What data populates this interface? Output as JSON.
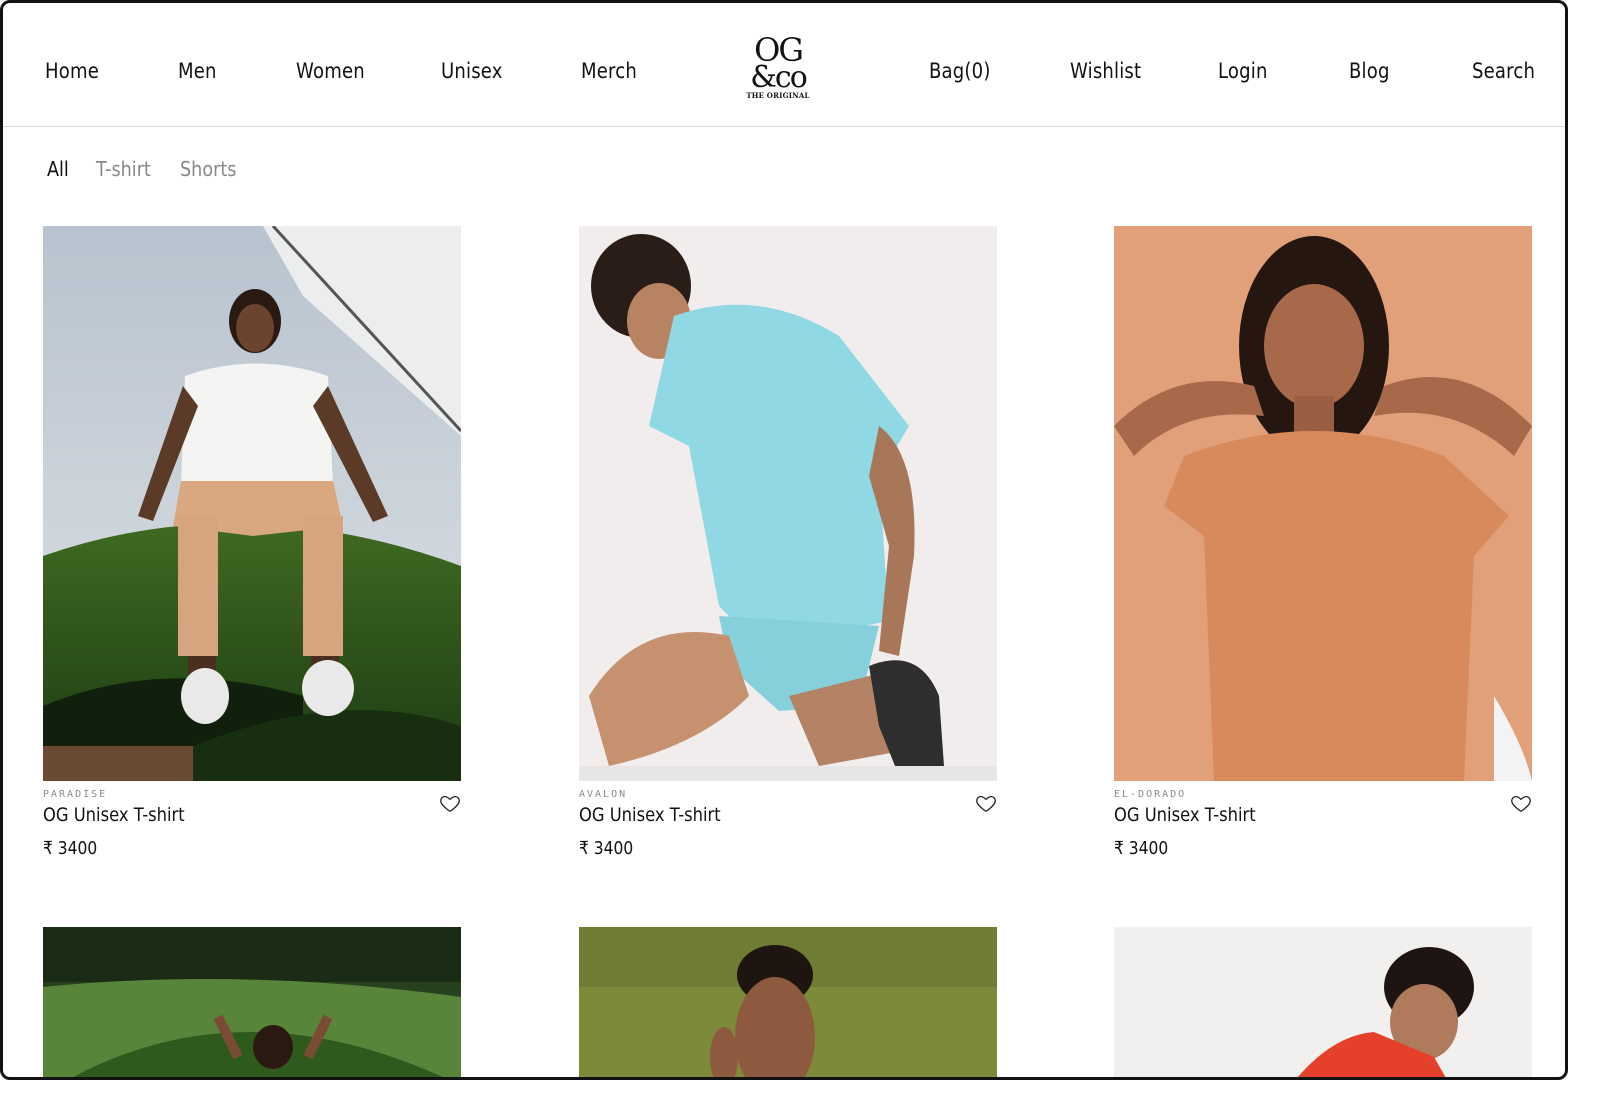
{
  "nav": {
    "left": [
      "Home",
      "Men",
      "Women",
      "Unisex",
      "Merch"
    ],
    "right": [
      "Bag(0)",
      "Wishlist",
      "Login",
      "Blog",
      "Search"
    ]
  },
  "logo": {
    "line1": "OG",
    "line2": "&co",
    "tagline": "THE ORIGINAL"
  },
  "filters": {
    "all": "All",
    "tshirt": "T-shirt",
    "shorts": "Shorts"
  },
  "products": [
    {
      "collection": "PARADISE",
      "name": "OG Unisex T-shirt",
      "price": "₹ 3400"
    },
    {
      "collection": "AVALON",
      "name": "OG Unisex T-shirt",
      "price": "₹ 3400"
    },
    {
      "collection": "EL-DORADO",
      "name": "OG Unisex T-shirt",
      "price": "₹ 3400"
    }
  ],
  "colors": {
    "accent": "#111111",
    "muted": "#888888",
    "divider": "#d9d9d9"
  }
}
